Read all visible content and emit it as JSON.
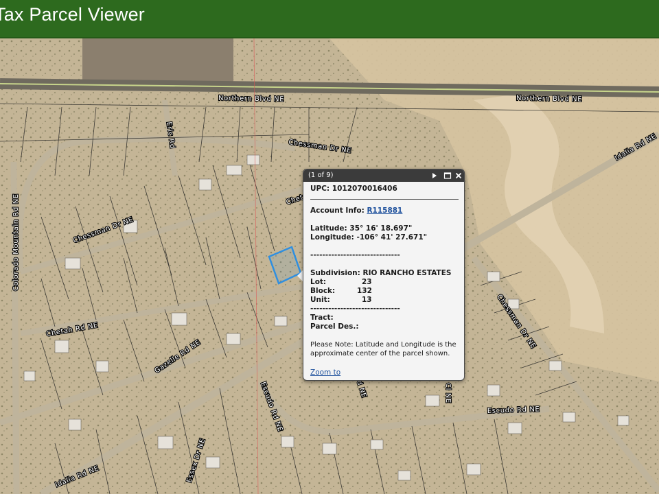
{
  "app": {
    "title": "Tax Parcel Viewer"
  },
  "map": {
    "road_labels": [
      "Northern Blvd NE",
      "Northern Blvd NE",
      "Chessman Dr NE",
      "Chessman Dr NE",
      "Idalia Rd NE",
      "Colorado Mountain Rd NE",
      "Eric Rd",
      "Chetah Rd NE",
      "Cheta",
      "Gazelle Rd NE",
      "Escudo Rd NE",
      "Escudo Rd NE",
      "Chessman Dr NE",
      "Idalia Rd NE",
      "Essex Dr NE",
      "d NE",
      "Cl NE"
    ],
    "selection_color": "#2f8fe0"
  },
  "popup": {
    "count": "(1 of 9)",
    "upc_label": "UPC:",
    "upc_value": "1012070016406",
    "account_label": "Account Info:",
    "account_value": "R115881",
    "latitude_label": "Latitude:",
    "latitude_value": "35° 16' 18.697\"",
    "longitude_label": "Longitude:",
    "longitude_value": "-106° 41' 27.671\"",
    "divider": "------------------------------",
    "subdivision_label": "Subdivision:",
    "subdivision_value": "RIO RANCHO ESTATES",
    "lot_label": "Lot:",
    "lot_value": "23",
    "block_label": "Block:",
    "block_value": "132",
    "unit_label": "Unit:",
    "unit_value": "13",
    "tract_label": "Tract:",
    "parcel_des_label": "Parcel Des.:",
    "note": "Please Note: Latitude and Longitude is the approximate center of the parcel shown.",
    "zoom_label": "Zoom to",
    "buttons": {
      "next": "play-icon",
      "maximize": "maximize-icon",
      "close": "close-icon"
    }
  }
}
